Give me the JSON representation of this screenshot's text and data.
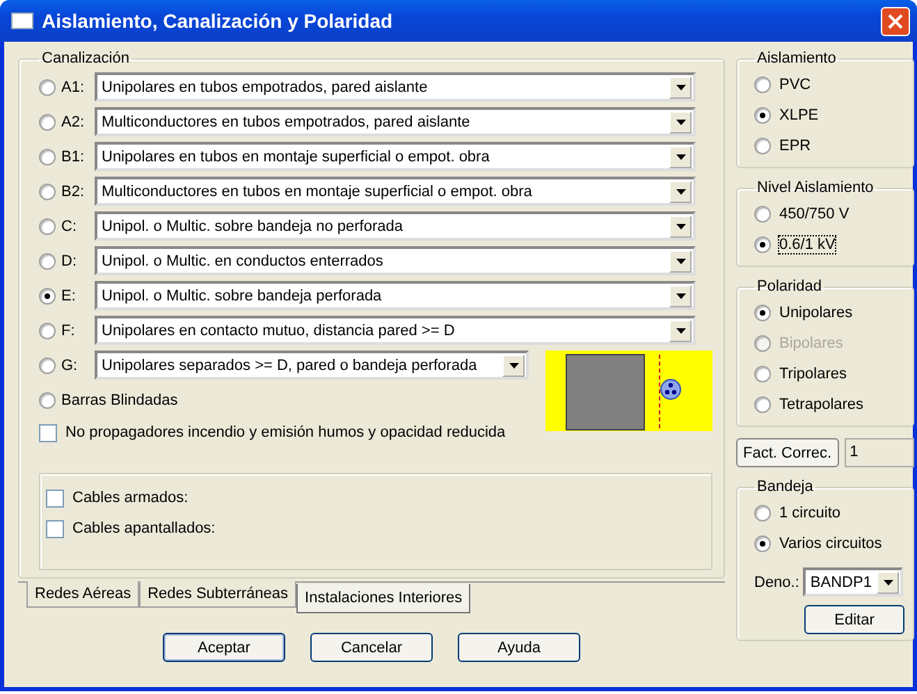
{
  "window": {
    "title": "Aislamiento, Canalización y Polaridad"
  },
  "canalizacion": {
    "title": "Canalización",
    "options": [
      {
        "kind": "wide",
        "label": "A1:",
        "value": "Unipolares en tubos empotrados, pared aislante",
        "selected": false
      },
      {
        "kind": "wide",
        "label": "A2:",
        "value": "Multiconductores en tubos empotrados, pared aislante",
        "selected": false
      },
      {
        "kind": "wide",
        "label": "B1:",
        "value": "Unipolares en tubos en montaje superficial o empot. obra",
        "selected": false
      },
      {
        "kind": "wide",
        "label": "B2:",
        "value": "Multiconductores en tubos en montaje superficial o empot. obra",
        "selected": false
      },
      {
        "kind": "wide",
        "label": "C:",
        "value": "Unipol. o Multic. sobre bandeja no perforada",
        "selected": false
      },
      {
        "kind": "wide",
        "label": "D:",
        "value": "Unipol. o Multic. en conductos enterrados",
        "selected": false
      },
      {
        "kind": "wide",
        "label": "E:",
        "value": "Unipol. o Multic. sobre bandeja perforada",
        "selected": true
      },
      {
        "kind": "wide",
        "label": "F:",
        "value": "Unipolares en contacto mutuo, distancia pared >= D",
        "selected": false
      },
      {
        "kind": "narrow",
        "label": "G:",
        "value": "Unipolares separados >= D, pared o bandeja perforada",
        "selected": false
      },
      {
        "kind": "plain",
        "label": "Barras Blindadas",
        "selected": false
      }
    ],
    "no_propagadores": {
      "label": "No propagadores incendio y emisión humos y opacidad reducida",
      "checked": false
    },
    "cables": [
      {
        "label": "Cables armados:",
        "checked": false
      },
      {
        "label": "Cables apantallados:",
        "checked": false
      }
    ]
  },
  "tabs": [
    {
      "label": "Redes Aéreas",
      "selected": false
    },
    {
      "label": "Redes Subterráneas",
      "selected": false
    },
    {
      "label": "Instalaciones Interiores",
      "selected": true
    }
  ],
  "buttons": [
    "Aceptar",
    "Cancelar",
    "Ayuda"
  ],
  "aislamiento": {
    "title": "Aislamiento",
    "options": [
      {
        "label": "PVC",
        "selected": false
      },
      {
        "label": "XLPE",
        "selected": true
      },
      {
        "label": "EPR",
        "selected": false
      }
    ]
  },
  "nivel_aislamiento": {
    "title": "Nivel Aislamiento",
    "options": [
      {
        "label": "450/750 V",
        "selected": false,
        "focused": false
      },
      {
        "label": "0.6/1 kV",
        "selected": true,
        "focused": true
      }
    ]
  },
  "polaridad": {
    "title": "Polaridad",
    "options": [
      {
        "label": "Unipolares",
        "selected": true,
        "disabled": false
      },
      {
        "label": "Bipolares",
        "selected": false,
        "disabled": true
      },
      {
        "label": "Tripolares",
        "selected": false,
        "disabled": false
      },
      {
        "label": "Tetrapolares",
        "selected": false,
        "disabled": false
      }
    ]
  },
  "fact_correc": {
    "button": "Fact. Correc.",
    "value": "1"
  },
  "bandeja": {
    "title": "Bandeja",
    "options": [
      {
        "label": "1 circuito",
        "selected": false
      },
      {
        "label": "Varios circuitos",
        "selected": true
      }
    ],
    "deno_label": "Deno.:",
    "deno_value": "BANDP1",
    "edit_button": "Editar"
  }
}
